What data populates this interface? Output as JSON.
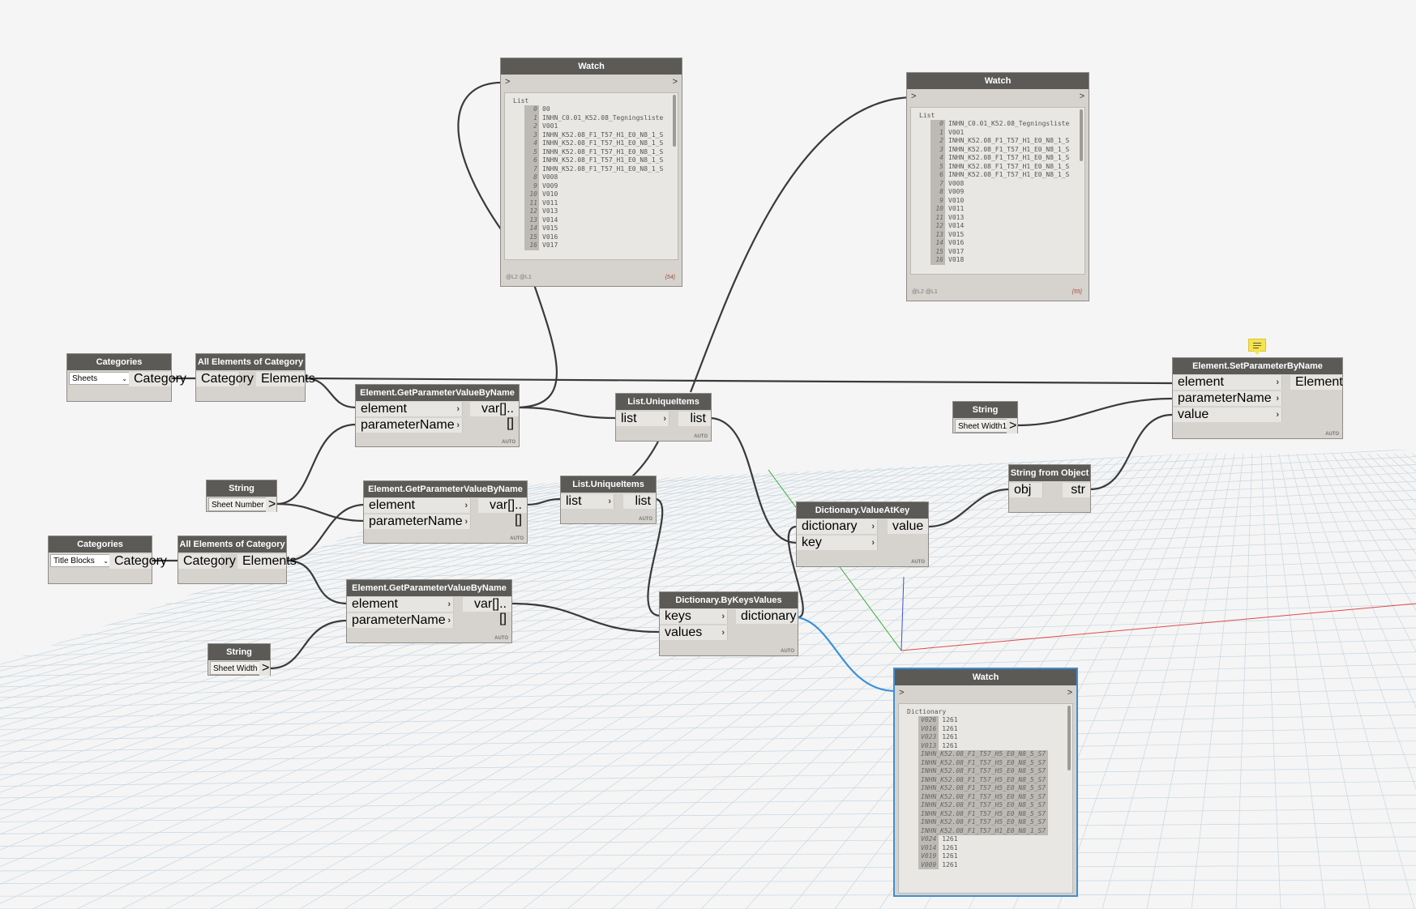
{
  "nodes": {
    "categories_sheets": {
      "title": "Categories",
      "selected": "Sheets",
      "out": "Category"
    },
    "all_elements_1": {
      "title": "All Elements of Category",
      "in": "Category",
      "out": "Elements"
    },
    "get_param_1": {
      "title": "Element.GetParameterValueByName",
      "in1": "element",
      "in2": "parameterName",
      "out": "var[]..[]",
      "lacing": "AUTO"
    },
    "unique_1": {
      "title": "List.UniqueItems",
      "in": "list",
      "out": "list",
      "lacing": "AUTO"
    },
    "set_param": {
      "title": "Element.SetParameterByName",
      "in1": "element",
      "in2": "parameterName",
      "in3": "value",
      "out": "Element",
      "lacing": "AUTO"
    },
    "string_sheet_width1": {
      "title": "String",
      "value": "Sheet Width1",
      "out": ">"
    },
    "string_sheet_number": {
      "title": "String",
      "value": "Sheet Number",
      "out": ">"
    },
    "get_param_2": {
      "title": "Element.GetParameterValueByName",
      "in1": "element",
      "in2": "parameterName",
      "out": "var[]..[]",
      "lacing": "AUTO"
    },
    "unique_2": {
      "title": "List.UniqueItems",
      "in": "list",
      "out": "list",
      "lacing": "AUTO"
    },
    "string_from_object": {
      "title": "String from Object",
      "in": "obj",
      "out": "str"
    },
    "dict_value_at_key": {
      "title": "Dictionary.ValueAtKey",
      "in1": "dictionary",
      "in2": "key",
      "out": "value",
      "lacing": "AUTO"
    },
    "categories_titleblocks": {
      "title": "Categories",
      "selected": "Title Blocks",
      "out": "Category"
    },
    "all_elements_2": {
      "title": "All Elements of Category",
      "in": "Category",
      "out": "Elements"
    },
    "get_param_3": {
      "title": "Element.GetParameterValueByName",
      "in1": "element",
      "in2": "parameterName",
      "out": "var[]..[]",
      "lacing": "AUTO"
    },
    "dict_by_keys_values": {
      "title": "Dictionary.ByKeysValues",
      "in1": "keys",
      "in2": "values",
      "out": "dictionary",
      "lacing": "AUTO"
    },
    "string_sheet_width": {
      "title": "String",
      "value": "Sheet Width",
      "out": ">"
    }
  },
  "watches": {
    "watch_1": {
      "title": "Watch",
      "in": ">",
      "out": ">",
      "list_type": "List",
      "levels": "@L2 @L1",
      "count": "{54}",
      "items": [
        {
          "i": "0",
          "v": "00"
        },
        {
          "i": "1",
          "v": "INHN_C0.01_K52.08_Tegningsliste"
        },
        {
          "i": "2",
          "v": "V001"
        },
        {
          "i": "3",
          "v": "INHN_K52.08_F1_T57_H1_E0_N8_1_S"
        },
        {
          "i": "4",
          "v": "INHN_K52.08_F1_T57_H1_E0_N8_1_S"
        },
        {
          "i": "5",
          "v": "INHN_K52.08_F1_T57_H1_E0_N8_1_S"
        },
        {
          "i": "6",
          "v": "INHN_K52.08_F1_T57_H1_E0_N8_1_S"
        },
        {
          "i": "7",
          "v": "INHN_K52.08_F1_T57_H1_E0_N8_1_S"
        },
        {
          "i": "8",
          "v": "V008"
        },
        {
          "i": "9",
          "v": "V009"
        },
        {
          "i": "10",
          "v": "V010"
        },
        {
          "i": "11",
          "v": "V011"
        },
        {
          "i": "12",
          "v": "V013"
        },
        {
          "i": "13",
          "v": "V014"
        },
        {
          "i": "14",
          "v": "V015"
        },
        {
          "i": "15",
          "v": "V016"
        },
        {
          "i": "16",
          "v": "V017"
        }
      ]
    },
    "watch_2": {
      "title": "Watch",
      "in": ">",
      "out": ">",
      "list_type": "List",
      "levels": "@L2 @L1",
      "count": "{55}",
      "items": [
        {
          "i": "0",
          "v": "INHN_C0.01_K52.08_Tegningsliste"
        },
        {
          "i": "1",
          "v": "V001"
        },
        {
          "i": "2",
          "v": "INHN_K52.08_F1_T57_H1_E0_N8_1_S"
        },
        {
          "i": "3",
          "v": "INHN_K52.08_F1_T57_H1_E0_N8_1_S"
        },
        {
          "i": "4",
          "v": "INHN_K52.08_F1_T57_H1_E0_N8_1_S"
        },
        {
          "i": "5",
          "v": "INHN_K52.08_F1_T57_H1_E0_N8_1_S"
        },
        {
          "i": "6",
          "v": "INHN_K52.08_F1_T57_H1_E0_N8_1_S"
        },
        {
          "i": "7",
          "v": "V008"
        },
        {
          "i": "8",
          "v": "V009"
        },
        {
          "i": "9",
          "v": "V010"
        },
        {
          "i": "10",
          "v": "V011"
        },
        {
          "i": "11",
          "v": "V013"
        },
        {
          "i": "12",
          "v": "V014"
        },
        {
          "i": "13",
          "v": "V015"
        },
        {
          "i": "14",
          "v": "V016"
        },
        {
          "i": "15",
          "v": "V017"
        },
        {
          "i": "16",
          "v": "V018"
        }
      ]
    },
    "watch_3": {
      "title": "Watch",
      "in": ">",
      "out": ">",
      "list_type": "Dictionary",
      "items": [
        {
          "k": "V026",
          "v": "1261"
        },
        {
          "k": "V016",
          "v": "1261"
        },
        {
          "k": "V023",
          "v": "1261"
        },
        {
          "k": "V013",
          "v": "1261"
        },
        {
          "k": "INHN_K52.08_F1_T57_H5_E0_N8_5_S7",
          "v": ""
        },
        {
          "k": "INHN_K52.08_F1_T57_H5_E0_N8_5_S7",
          "v": ""
        },
        {
          "k": "INHN_K52.08_F1_T57_H5_E0_N8_5_S7",
          "v": ""
        },
        {
          "k": "INHN_K52.08_F1_T57_H5_E0_N8_5_S7",
          "v": ""
        },
        {
          "k": "INHN_K52.08_F1_T57_H5_E0_N8_5_S7",
          "v": ""
        },
        {
          "k": "INHN_K52.08_F1_T57_H5_E0_N8_5_S7",
          "v": ""
        },
        {
          "k": "INHN_K52.08_F1_T57_H5_E0_N8_5_S7",
          "v": ""
        },
        {
          "k": "INHN_K52.08_F1_T57_H5_E0_N8_5_S7",
          "v": ""
        },
        {
          "k": "INHN_K52.08_F1_T57_H5_E0_N8_5_S7",
          "v": ""
        },
        {
          "k": "INHN_K52.08_F1_T57_H1_E0_N8_1_S7",
          "v": ""
        },
        {
          "k": "V024",
          "v": "1261"
        },
        {
          "k": "V014",
          "v": "1261"
        },
        {
          "k": "V019",
          "v": "1261"
        },
        {
          "k": "V009",
          "v": "1261"
        }
      ]
    }
  },
  "colors": {
    "wire": "#3a3a3a",
    "wire_selected": "#3a8fd8",
    "grid": "#c7d7e1",
    "axis_x": "#e04b4b",
    "axis_y": "#3bab3b",
    "axis_z": "#3f4fd8",
    "node_header": "#5b5a57"
  }
}
